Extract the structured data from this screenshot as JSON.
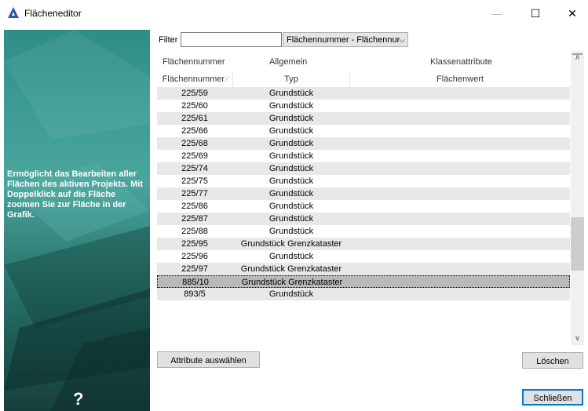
{
  "window": {
    "title": "Flächeneditor",
    "app_icon": "app-logo-icon",
    "controls": [
      "minimize",
      "maximize",
      "close"
    ]
  },
  "left_panel": {
    "description": "Ermöglicht das Bearbeiten aller Flächen des aktiven Projekts. Mit Doppelklick auf die Fläche zoomen Sie zur Fläche in der Grafik.",
    "help_label": "?"
  },
  "filter": {
    "label": "Filter",
    "value": "",
    "select_value": "Flächennummer - Flächennur"
  },
  "groups": {
    "g1": "Flächennummer",
    "g2": "Allgemein",
    "g3": "Klassenattribute"
  },
  "columns": {
    "c1": "Flächennummer",
    "c2": "Typ",
    "c3": "Flächenwert"
  },
  "rows": [
    {
      "num": "225/59",
      "typ": "Grundstück"
    },
    {
      "num": "225/60",
      "typ": "Grundstück"
    },
    {
      "num": "225/61",
      "typ": "Grundstück"
    },
    {
      "num": "225/66",
      "typ": "Grundstück"
    },
    {
      "num": "225/68",
      "typ": "Grundstück"
    },
    {
      "num": "225/69",
      "typ": "Grundstück"
    },
    {
      "num": "225/74",
      "typ": "Grundstück"
    },
    {
      "num": "225/75",
      "typ": "Grundstück"
    },
    {
      "num": "225/77",
      "typ": "Grundstück"
    },
    {
      "num": "225/86",
      "typ": "Grundstück"
    },
    {
      "num": "225/87",
      "typ": "Grundstück"
    },
    {
      "num": "225/88",
      "typ": "Grundstück"
    },
    {
      "num": "225/95",
      "typ": "Grundstück Grenzkataster"
    },
    {
      "num": "225/96",
      "typ": "Grundstück"
    },
    {
      "num": "225/97",
      "typ": "Grundstück Grenzkataster"
    },
    {
      "num": "885/10",
      "typ": "Grundstück Grenzkataster"
    },
    {
      "num": "893/5",
      "typ": "Grundstück"
    }
  ],
  "selected_row_index": 15,
  "buttons": {
    "attribute": "Attribute auswählen",
    "delete": "Löschen",
    "close": "Schließen"
  },
  "colors": {
    "accent": "#0078d7",
    "panel_teal": "#3c9b94",
    "row_alt": "#e8e8e8",
    "row_selected": "#b9b9b9"
  }
}
